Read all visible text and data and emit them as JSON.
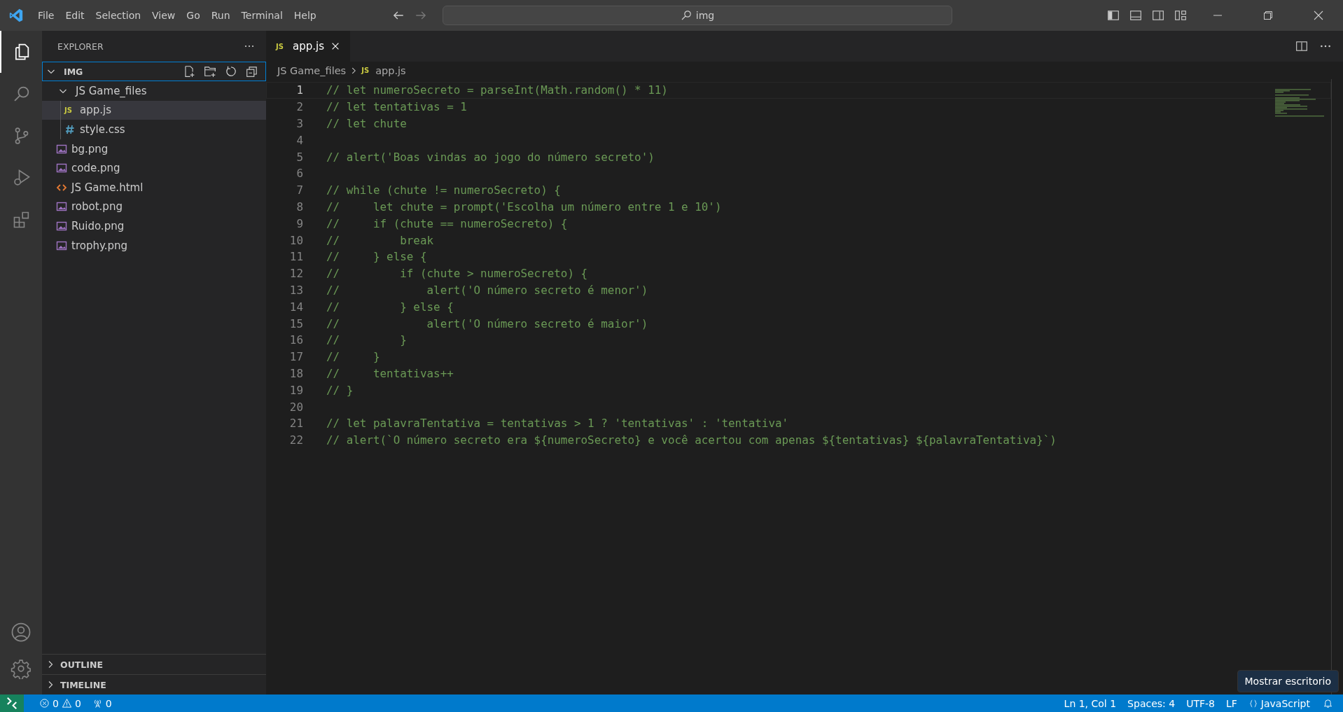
{
  "window": {
    "menu": [
      "File",
      "Edit",
      "Selection",
      "View",
      "Go",
      "Run",
      "Terminal",
      "Help"
    ],
    "search": {
      "value": "img"
    }
  },
  "activity_bar": {
    "items": [
      {
        "kind": "explorer",
        "selected": true
      },
      {
        "kind": "search",
        "selected": false
      },
      {
        "kind": "source-control",
        "selected": false
      },
      {
        "kind": "run-debug",
        "selected": false
      },
      {
        "kind": "extensions",
        "selected": false
      }
    ]
  },
  "explorer": {
    "title": "EXPLORER",
    "folder": {
      "label": "IMG",
      "expanded": true
    },
    "tree": [
      {
        "label": "JS Game_files",
        "kind": "folder",
        "expanded": true,
        "selected": false,
        "children": [
          {
            "label": "app.js",
            "kind": "js",
            "icon_label": "JS",
            "selected": true
          },
          {
            "label": "style.css",
            "kind": "css",
            "selected": false
          }
        ]
      },
      {
        "label": "bg.png",
        "kind": "image",
        "selected": false
      },
      {
        "label": "code.png",
        "kind": "image",
        "selected": false
      },
      {
        "label": "JS Game.html",
        "kind": "html",
        "selected": false
      },
      {
        "label": "robot.png",
        "kind": "image",
        "selected": false
      },
      {
        "label": "Ruido.png",
        "kind": "image",
        "selected": false
      },
      {
        "label": "trophy.png",
        "kind": "image",
        "selected": false
      }
    ],
    "sections": [
      {
        "label": "OUTLINE",
        "expanded": false
      },
      {
        "label": "TIMELINE",
        "expanded": false
      }
    ]
  },
  "tabs": [
    {
      "label": "app.js",
      "kind": "js",
      "icon_label": "JS",
      "selected": true
    }
  ],
  "breadcrumb": [
    {
      "label": "JS Game_files",
      "kind": "folder"
    },
    {
      "label": "app.js",
      "kind": "js",
      "icon_label": "JS"
    }
  ],
  "editor": {
    "lines": [
      {
        "number": "1",
        "text": "// let numeroSecreto = parseInt(Math.random() * 11)",
        "current": true
      },
      {
        "number": "2",
        "text": "// let tentativas = 1",
        "current": false
      },
      {
        "number": "3",
        "text": "// let chute",
        "current": false
      },
      {
        "number": "4",
        "current": false
      },
      {
        "number": "5",
        "text": "// alert('Boas vindas ao jogo do número secreto')",
        "current": false
      },
      {
        "number": "6",
        "current": false
      },
      {
        "number": "7",
        "text": "// while (chute != numeroSecreto) {",
        "current": false
      },
      {
        "number": "8",
        "text": "//     let chute = prompt('Escolha um número entre 1 e 10')",
        "current": false
      },
      {
        "number": "9",
        "text": "//     if (chute == numeroSecreto) {",
        "current": false
      },
      {
        "number": "10",
        "text": "//         break",
        "current": false
      },
      {
        "number": "11",
        "text": "//     } else {",
        "current": false
      },
      {
        "number": "12",
        "text": "//         if (chute > numeroSecreto) {",
        "current": false
      },
      {
        "number": "13",
        "text": "//             alert('O número secreto é menor')",
        "current": false
      },
      {
        "number": "14",
        "text": "//         } else {",
        "current": false
      },
      {
        "number": "15",
        "text": "//             alert('O número secreto é maior')",
        "current": false
      },
      {
        "number": "16",
        "text": "//         }",
        "current": false
      },
      {
        "number": "17",
        "text": "//     }",
        "current": false
      },
      {
        "number": "18",
        "text": "//     tentativas++",
        "current": false
      },
      {
        "number": "19",
        "text": "// }",
        "current": false
      },
      {
        "number": "20",
        "current": false
      },
      {
        "number": "21",
        "text": "// let palavraTentativa = tentativas > 1 ? 'tentativas' : 'tentativa'",
        "current": false
      },
      {
        "number": "22",
        "text": "// alert(`O número secreto era ${numeroSecreto} e você acertou com apenas ${tentativas} ${palavraTentativa}`)",
        "current": false
      }
    ]
  },
  "status_bar": {
    "errors": "0",
    "warnings": "0",
    "ports": "0",
    "right": [
      {
        "label": "Ln 1, Col 1",
        "kind": "text"
      },
      {
        "label": "Spaces: 4",
        "kind": "text"
      },
      {
        "label": "UTF-8",
        "kind": "text"
      },
      {
        "label": "LF",
        "kind": "text"
      },
      {
        "label": "JavaScript",
        "kind": "language"
      }
    ]
  },
  "tooltip": {
    "text": "Mostrar escritorio"
  }
}
